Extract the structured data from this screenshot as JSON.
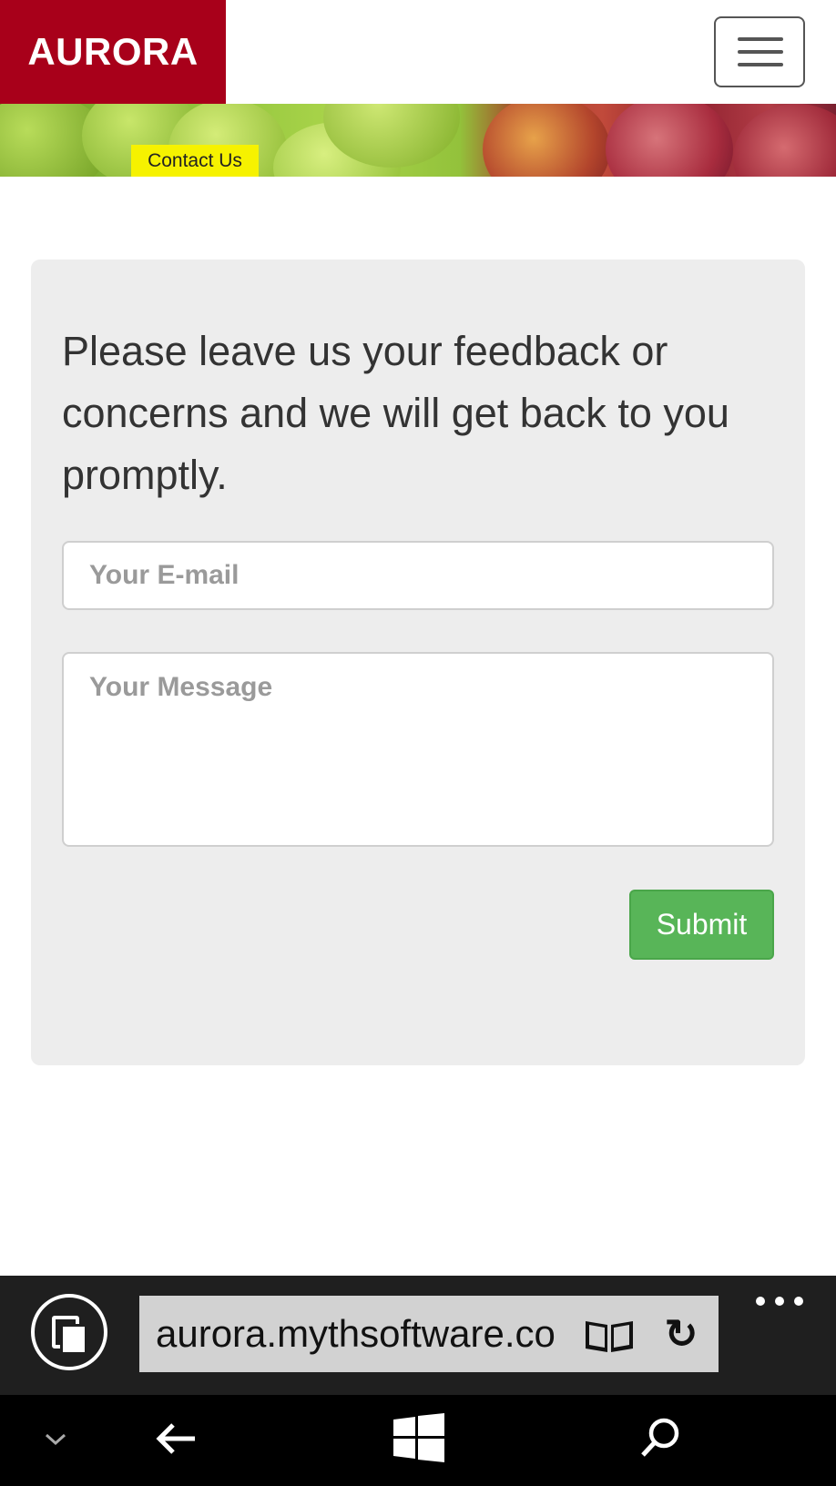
{
  "header": {
    "brand": "AURORA",
    "menu_icon": "hamburger-menu-icon"
  },
  "banner": {
    "label": "Contact Us"
  },
  "form": {
    "lead_text": "Please leave us your feedback or concerns and we will get back to you promptly.",
    "email_placeholder": "Your E-mail",
    "email_value": "",
    "message_placeholder": "Your Message",
    "message_value": "",
    "submit_label": "Submit"
  },
  "browser": {
    "url": "aurora.mythsoftware.com",
    "icons": [
      "tabs-icon",
      "reading-view-icon",
      "refresh-icon",
      "more-icon"
    ]
  },
  "system_nav": {
    "icons": [
      "chevron-down-icon",
      "back-arrow-icon",
      "windows-start-icon",
      "search-icon"
    ]
  },
  "colors": {
    "brand_red": "#a8001a",
    "submit_green": "#58b558",
    "label_yellow": "#f6f200",
    "panel_gray": "#ededed"
  }
}
